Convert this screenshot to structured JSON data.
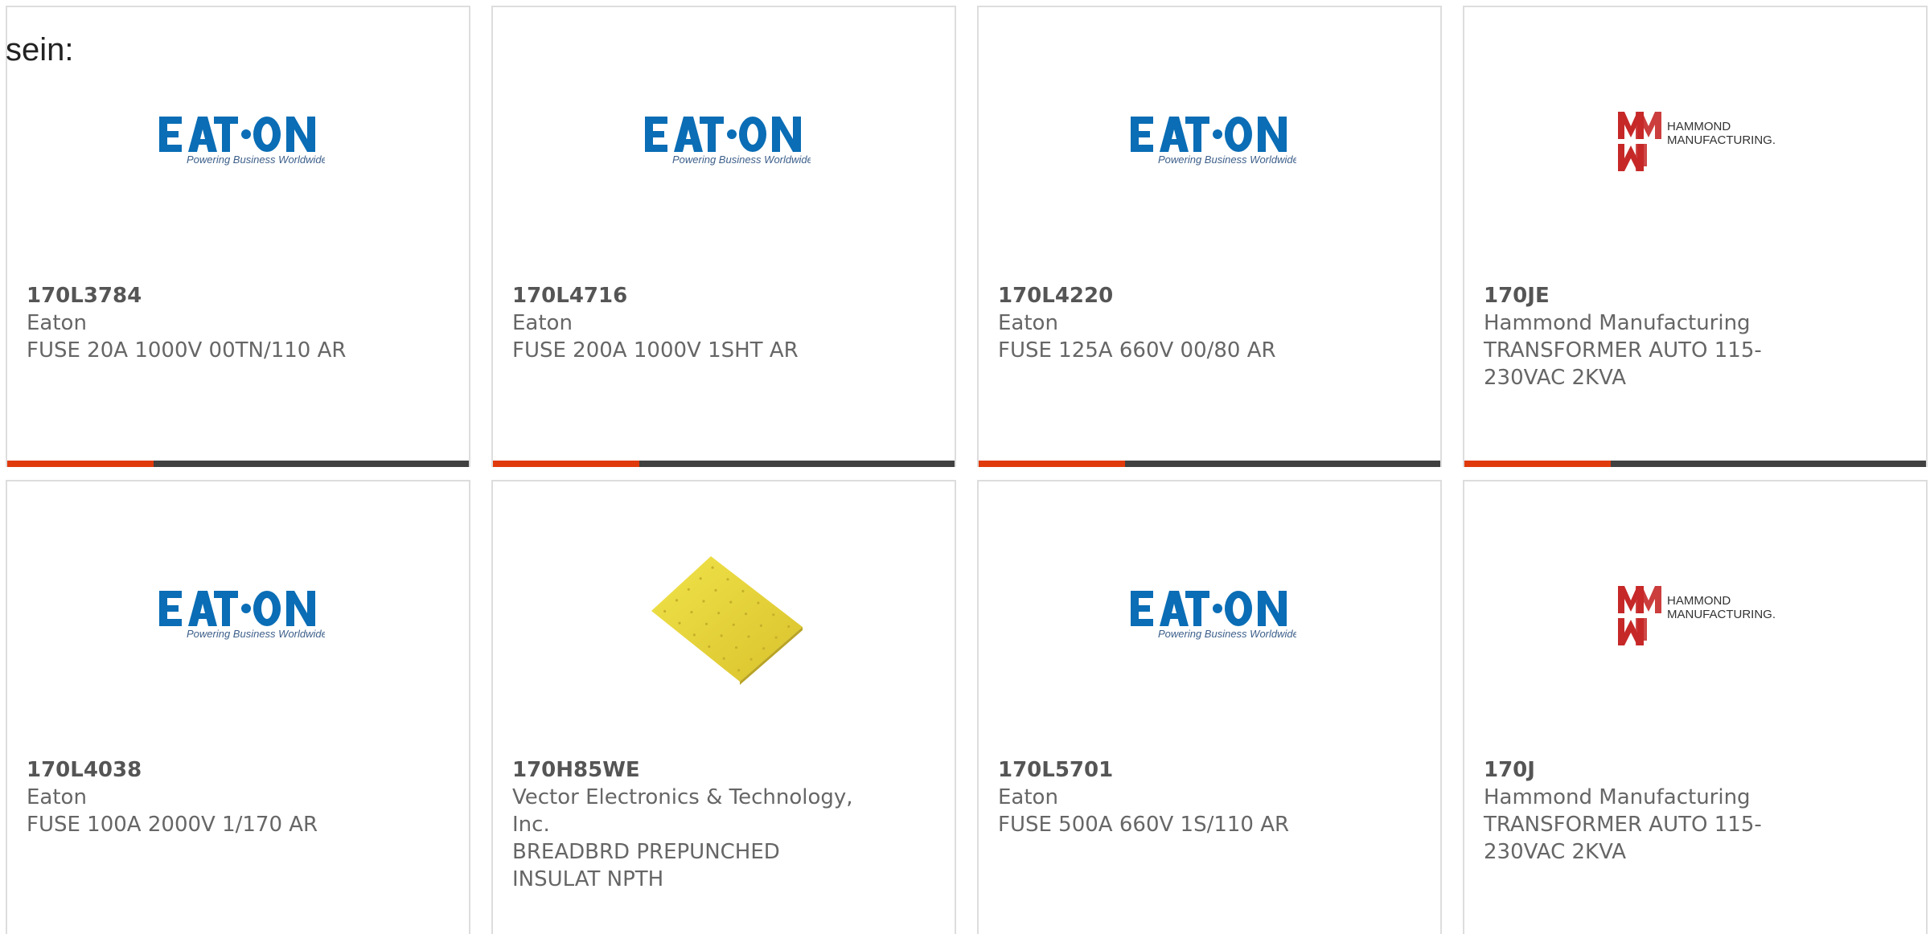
{
  "intro_text": "sein:",
  "brand_colors": {
    "accent_bar": "#e03a0c",
    "bar_dark": "#404040",
    "eaton_blue": "#0a6db5",
    "hammond_red": "#c62828"
  },
  "logos": {
    "eaton": {
      "word": "EAT N",
      "tagline": "Powering Business Worldwide"
    },
    "hammond": {
      "line1": "HAMMOND",
      "line2": "MANUFACTURING."
    }
  },
  "products": [
    {
      "part_number": "170L3784",
      "manufacturer": "Eaton",
      "description": "FUSE 20A 1000V 00TN/110 AR",
      "image": "eaton-logo"
    },
    {
      "part_number": "170L4716",
      "manufacturer": "Eaton",
      "description": "FUSE 200A 1000V 1SHT AR",
      "image": "eaton-logo"
    },
    {
      "part_number": "170L4220",
      "manufacturer": "Eaton",
      "description": "FUSE 125A 660V 00/80 AR",
      "image": "eaton-logo"
    },
    {
      "part_number": "170JE",
      "manufacturer": "Hammond Manufacturing",
      "description": "TRANSFORMER AUTO 115-230VAC 2KVA",
      "image": "hammond-logo"
    },
    {
      "part_number": "170L4038",
      "manufacturer": "Eaton",
      "description": "FUSE 100A 2000V 1/170 AR",
      "image": "eaton-logo"
    },
    {
      "part_number": "170H85WE",
      "manufacturer": "Vector Electronics & Technology, Inc.",
      "description": "BREADBRD PREPUNCHED INSULAT NPTH",
      "image": "breadboard-photo"
    },
    {
      "part_number": "170L5701",
      "manufacturer": "Eaton",
      "description": "FUSE 500A 660V 1S/110 AR",
      "image": "eaton-logo"
    },
    {
      "part_number": "170J",
      "manufacturer": "Hammond Manufacturing",
      "description": "TRANSFORMER AUTO 115-230VAC 2KVA",
      "image": "hammond-logo"
    }
  ]
}
